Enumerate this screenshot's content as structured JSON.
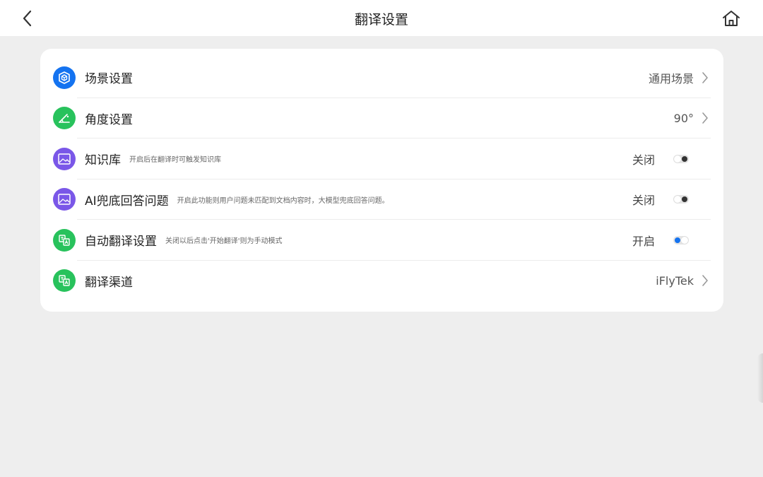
{
  "header": {
    "title": "翻译设置",
    "back_icon": "chevron-left-icon",
    "home_icon": "home-icon"
  },
  "settings": {
    "scene": {
      "label": "场景设置",
      "value": "通用场景",
      "icon": "scene-cube-icon"
    },
    "angle": {
      "label": "角度设置",
      "value": "90°",
      "icon": "angle-icon"
    },
    "knowledge": {
      "label": "知识库",
      "desc": "开启后在翻译时可触发知识库",
      "status": "关闭",
      "enabled": false,
      "icon": "image-icon"
    },
    "ai_fallback": {
      "label": "AI兜底回答问题",
      "desc": "开启此功能则用户问题未匹配到文档内容时，大模型兜底回答问题。",
      "status": "关闭",
      "enabled": false,
      "icon": "image-icon"
    },
    "auto_translate": {
      "label": "自动翻译设置",
      "desc": "关闭以后点击'开始翻译'则为手动模式",
      "status": "开启",
      "enabled": true,
      "icon": "translate-icon"
    },
    "channel": {
      "label": "翻译渠道",
      "value": "iFlyTek",
      "icon": "translate-icon"
    }
  },
  "colors": {
    "blue": "#1473f0",
    "green": "#28c25c",
    "purple": "#7a57e8",
    "background": "#eeeeee"
  }
}
